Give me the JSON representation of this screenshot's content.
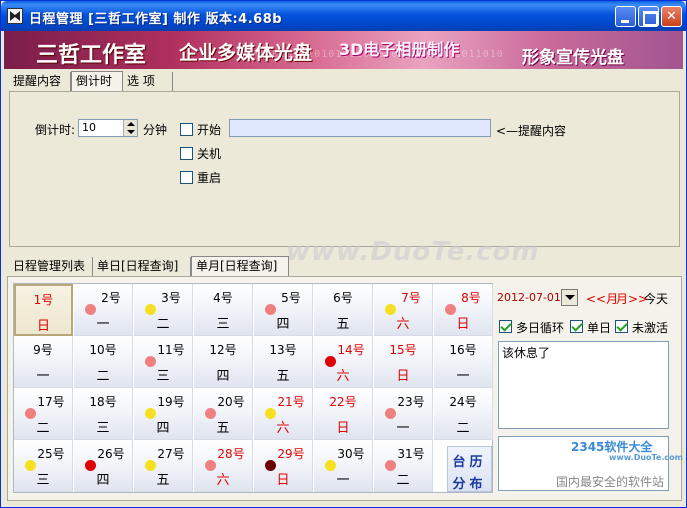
{
  "window": {
    "title": "日程管理 [三哲工作室] 制作  版本:4.68b"
  },
  "banner": {
    "studio": "三哲工作室",
    "slogan1": "企业多媒体光盘",
    "slogan2": "3D电子相册制作",
    "slogan3": "形象宣传光盘",
    "digits": "1010010101010101101010110100101011010"
  },
  "top_tabs": [
    "提醒内容",
    "倒计时",
    "选  项"
  ],
  "countdown": {
    "label": "倒计时:",
    "value": "10",
    "unit": "分钟",
    "start_label": "开始",
    "shutdown_label": "关机",
    "restart_label": "重启",
    "reminder_value": "",
    "reminder_label": "<—提醒内容"
  },
  "bottom_tabs": [
    "日程管理列表",
    "单日[日程查询]",
    "单月[日程查询]"
  ],
  "calendar": {
    "colors": {
      "pink": "#f08080",
      "yellow": "#f6e020",
      "red": "#e00000",
      "darkred": "#6b0000"
    },
    "cells": [
      {
        "day": "1号",
        "wd": "日",
        "color": "red",
        "dot": null,
        "today": true
      },
      {
        "day": "2号",
        "wd": "一",
        "color": "black",
        "dot": "pink"
      },
      {
        "day": "3号",
        "wd": "二",
        "color": "black",
        "dot": "yellow"
      },
      {
        "day": "4号",
        "wd": "三",
        "color": "black",
        "dot": null
      },
      {
        "day": "5号",
        "wd": "四",
        "color": "black",
        "dot": "pink"
      },
      {
        "day": "6号",
        "wd": "五",
        "color": "black",
        "dot": null
      },
      {
        "day": "7号",
        "wd": "六",
        "color": "red",
        "dot": "yellow"
      },
      {
        "day": "8号",
        "wd": "日",
        "color": "red",
        "dot": "pink"
      },
      {
        "day": "9号",
        "wd": "一",
        "color": "black",
        "dot": null
      },
      {
        "day": "10号",
        "wd": "二",
        "color": "black",
        "dot": null
      },
      {
        "day": "11号",
        "wd": "三",
        "color": "black",
        "dot": "pink"
      },
      {
        "day": "12号",
        "wd": "四",
        "color": "black",
        "dot": null
      },
      {
        "day": "13号",
        "wd": "五",
        "color": "black",
        "dot": null
      },
      {
        "day": "14号",
        "wd": "六",
        "color": "red",
        "dot": "red"
      },
      {
        "day": "15号",
        "wd": "日",
        "color": "red",
        "dot": null
      },
      {
        "day": "16号",
        "wd": "一",
        "color": "black",
        "dot": null
      },
      {
        "day": "17号",
        "wd": "二",
        "color": "black",
        "dot": "pink"
      },
      {
        "day": "18号",
        "wd": "三",
        "color": "black",
        "dot": null
      },
      {
        "day": "19号",
        "wd": "四",
        "color": "black",
        "dot": "yellow"
      },
      {
        "day": "20号",
        "wd": "五",
        "color": "black",
        "dot": "pink"
      },
      {
        "day": "21号",
        "wd": "六",
        "color": "red",
        "dot": "yellow"
      },
      {
        "day": "22号",
        "wd": "日",
        "color": "red",
        "dot": null
      },
      {
        "day": "23号",
        "wd": "一",
        "color": "black",
        "dot": "pink"
      },
      {
        "day": "24号",
        "wd": "二",
        "color": "black",
        "dot": null
      },
      {
        "day": "25号",
        "wd": "三",
        "color": "black",
        "dot": "yellow"
      },
      {
        "day": "26号",
        "wd": "四",
        "color": "black",
        "dot": "red"
      },
      {
        "day": "27号",
        "wd": "五",
        "color": "black",
        "dot": "yellow"
      },
      {
        "day": "28号",
        "wd": "六",
        "color": "red",
        "dot": "pink"
      },
      {
        "day": "29号",
        "wd": "日",
        "color": "red",
        "dot": "darkred"
      },
      {
        "day": "30号",
        "wd": "一",
        "color": "black",
        "dot": "yellow"
      },
      {
        "day": "31号",
        "wd": "二",
        "color": "black",
        "dot": "pink"
      }
    ],
    "almanac_line1": "台历",
    "almanac_line2": "分布"
  },
  "side": {
    "date": "2012-07-01",
    "prev_month": "<<月",
    "next_month": "月>>",
    "today": "今天",
    "multi_day_loop": "多日循环",
    "single_day": "单日",
    "inactive": "未激活",
    "memo_text": "该休息了"
  },
  "watermarks": {
    "duote": "www.DuoTe.com",
    "logo": "2345软件大全",
    "logo_url": "www.DuoTe.com",
    "slogan": "国内最安全的软件站"
  }
}
